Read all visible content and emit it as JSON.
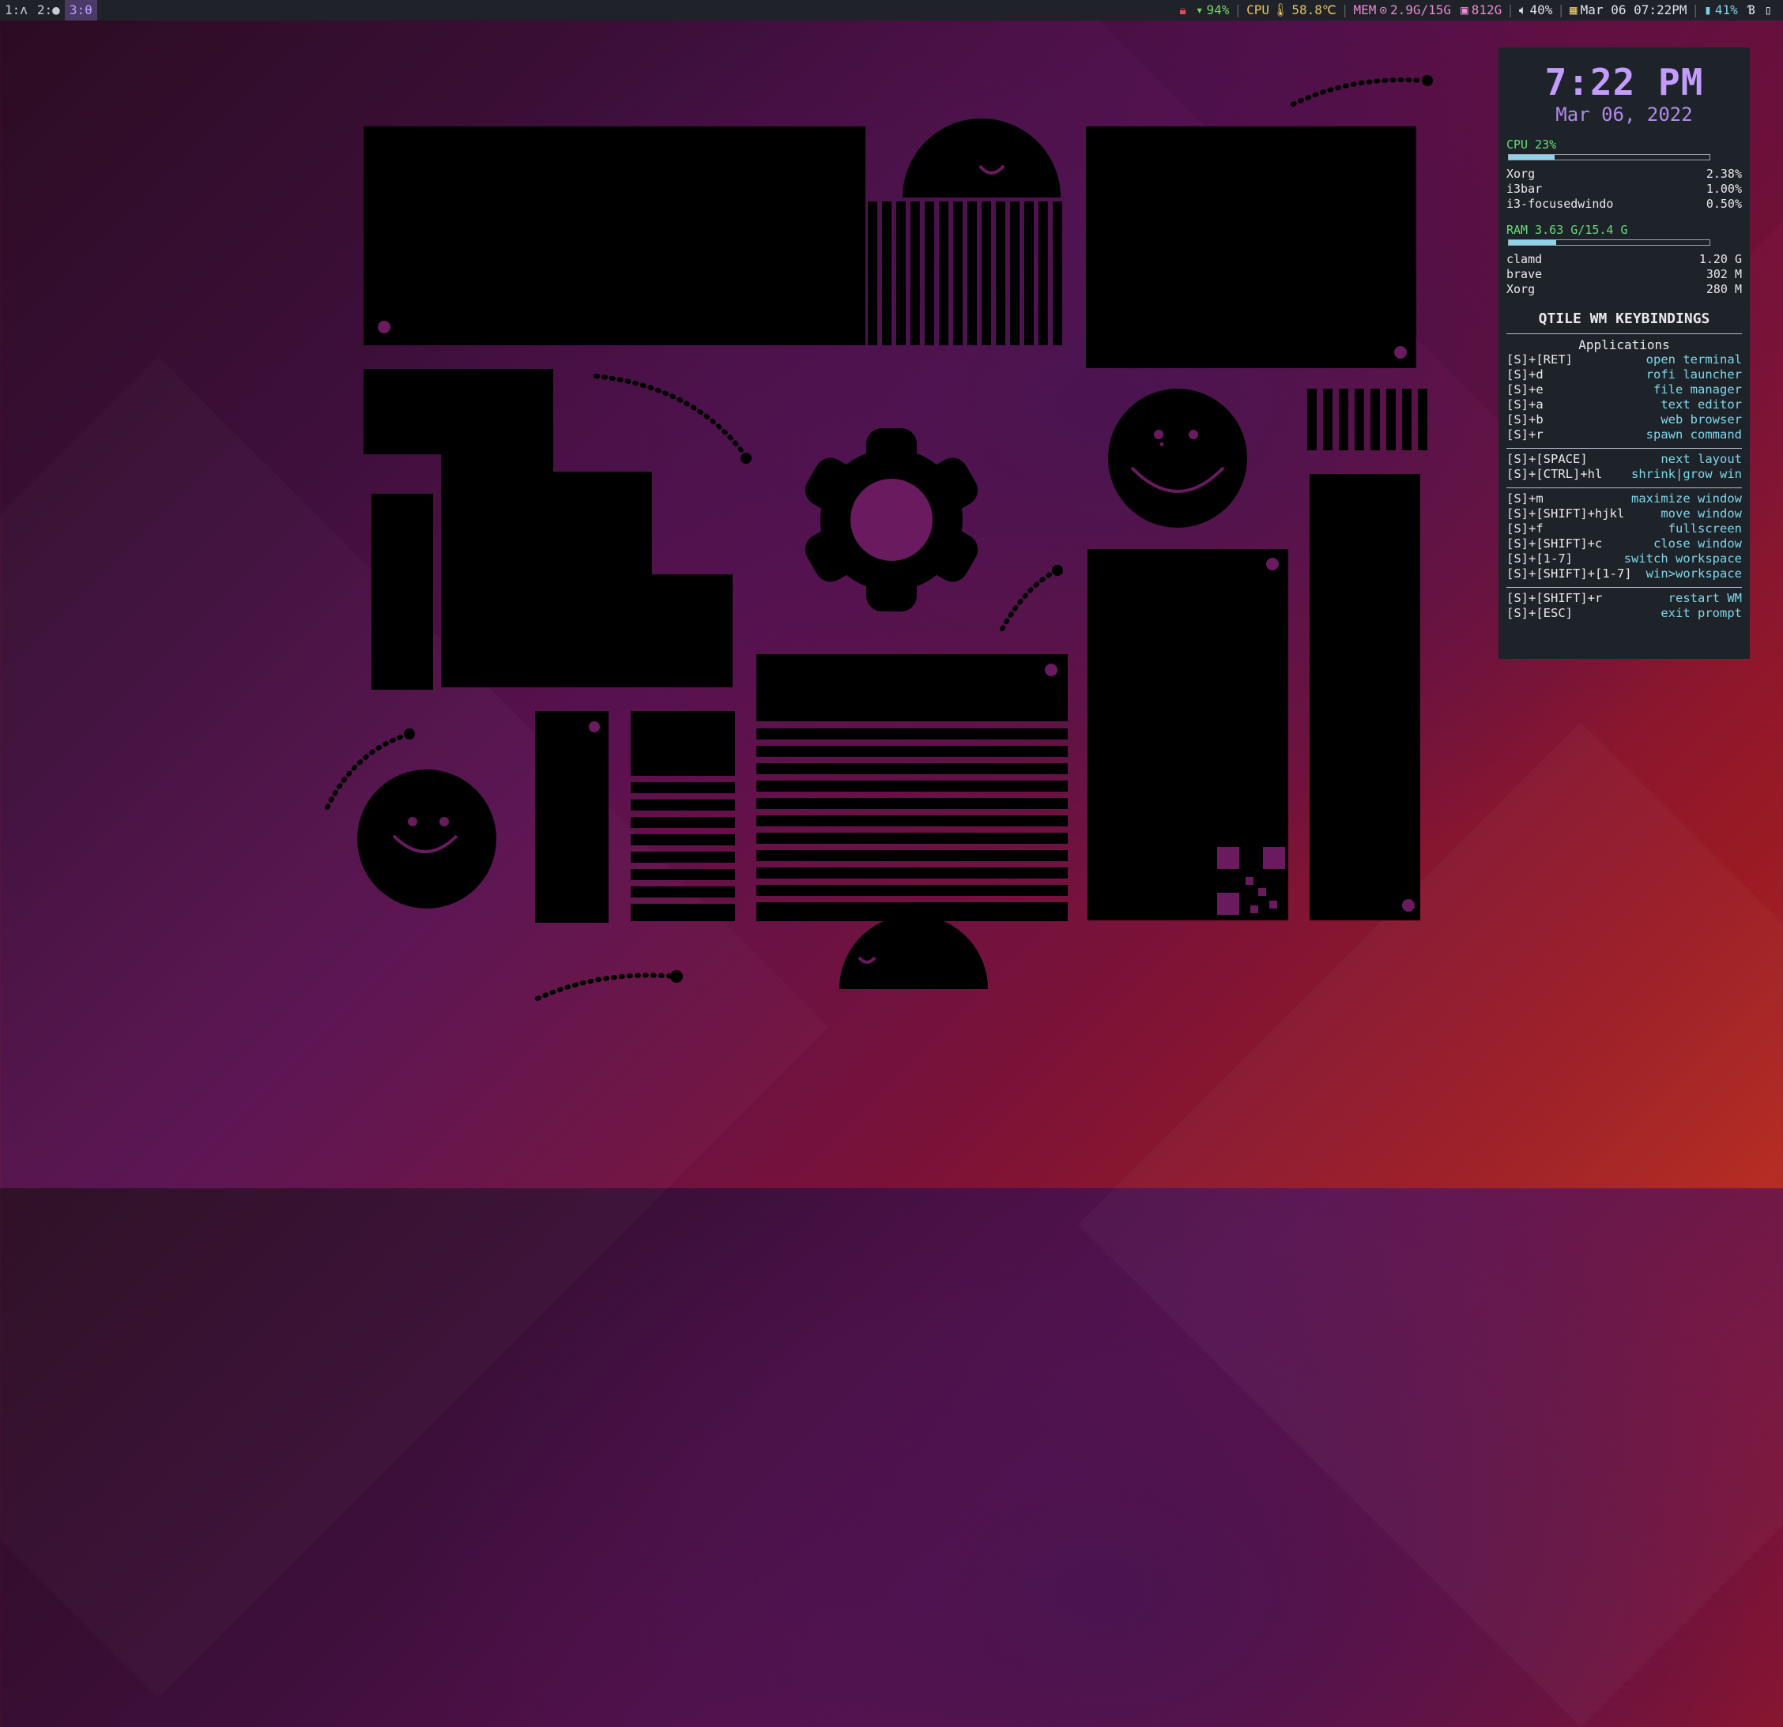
{
  "topbar": {
    "workspaces": [
      {
        "label": "1:ʌ",
        "active": false
      },
      {
        "label": "2:●",
        "active": false
      },
      {
        "label": "3:θ",
        "active": true
      }
    ],
    "wifi": "94%",
    "cpu_label": "CPU",
    "cpu_temp": "58.8℃",
    "mem_label": "MEM",
    "mem_value": "2.9G/15G",
    "disk_value": "812G",
    "volume": "40%",
    "datetime": "Mar 06 07:22PM",
    "battery": "41%"
  },
  "conky": {
    "time": "7:22 PM",
    "date": "Mar 06, 2022",
    "cpu_label": "CPU 23%",
    "cpu_fraction": 0.23,
    "cpu_procs": [
      {
        "name": "Xorg",
        "value": "2.38%"
      },
      {
        "name": "i3bar",
        "value": "1.00%"
      },
      {
        "name": "i3-focusedwindo",
        "value": "0.50%"
      }
    ],
    "ram_label": "RAM 3.63 G/15.4 G",
    "ram_fraction": 0.236,
    "ram_procs": [
      {
        "name": "clamd",
        "value": "1.20 G"
      },
      {
        "name": "brave",
        "value": "302 M"
      },
      {
        "name": "Xorg",
        "value": "280 M"
      }
    ],
    "title": "QTILE WM KEYBINDINGS",
    "apps_heading": "Applications",
    "groups": [
      [
        {
          "key": "[S]+[RET]",
          "action": "open terminal"
        },
        {
          "key": "[S]+d",
          "action": "rofi launcher"
        },
        {
          "key": "[S]+e",
          "action": "file manager"
        },
        {
          "key": "[S]+a",
          "action": "text editor"
        },
        {
          "key": "[S]+b",
          "action": "web browser"
        },
        {
          "key": "[S]+r",
          "action": "spawn command"
        }
      ],
      [
        {
          "key": "[S]+[SPACE]",
          "action": "next layout"
        },
        {
          "key": "[S]+[CTRL]+hl",
          "action": "shrink|grow win"
        }
      ],
      [
        {
          "key": "[S]+m",
          "action": "maximize window"
        },
        {
          "key": "[S]+[SHIFT]+hjkl",
          "action": "move window"
        },
        {
          "key": "[S]+f",
          "action": "fullscreen"
        },
        {
          "key": "[S]+[SHIFT]+c",
          "action": "close window"
        },
        {
          "key": "[S]+[1-7]",
          "action": "switch workspace"
        },
        {
          "key": "[S]+[SHIFT]+[1-7]",
          "action": "win>workspace"
        }
      ],
      [
        {
          "key": "[S]+[SHIFT]+r",
          "action": "restart WM"
        },
        {
          "key": "[S]+[ESC]",
          "action": "exit prompt"
        }
      ]
    ]
  },
  "colors": {
    "bar_bg": "#1f2228",
    "panel_bg": "#1e2329",
    "accent_purple": "#c49bff",
    "accent_green": "#66dd7a",
    "accent_cyan": "#7fd6ea"
  }
}
